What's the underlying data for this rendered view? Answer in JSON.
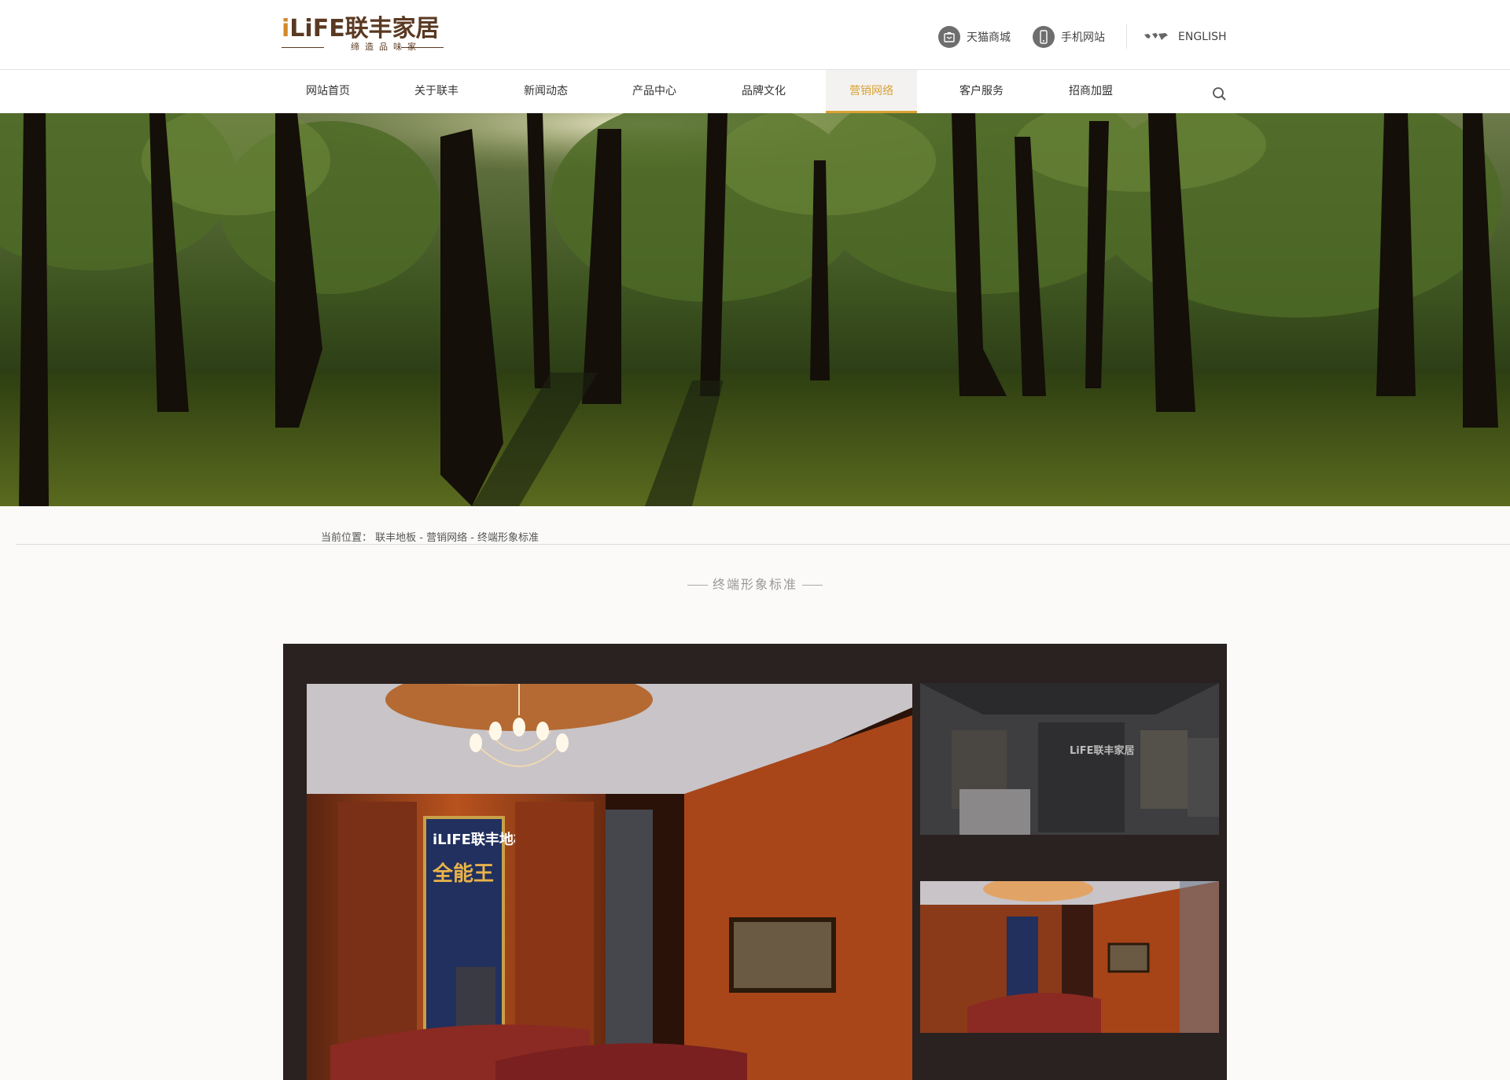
{
  "logo": {
    "brand": "LiFE联丰家居",
    "brand_i": "i",
    "tagline": "缔造品味家"
  },
  "toplinks": [
    {
      "label": "天猫商城",
      "icon": "tmall-bag-icon"
    },
    {
      "label": "手机网站",
      "icon": "mobile-phone-icon"
    },
    {
      "label": "ENGLISH",
      "icon": "world-map-icon"
    }
  ],
  "nav": {
    "items": [
      {
        "label": "网站首页"
      },
      {
        "label": "关于联丰"
      },
      {
        "label": "新闻动态"
      },
      {
        "label": "产品中心"
      },
      {
        "label": "品牌文化"
      },
      {
        "label": "营销网络",
        "active": true
      },
      {
        "label": "客户服务"
      },
      {
        "label": "招商加盟"
      }
    ],
    "active_color": "#d8a133"
  },
  "breadcrumb": {
    "text": "当前位置： 联丰地板 - 营销网络 - 终端形象标准"
  },
  "section": {
    "title": "终端形象标准"
  },
  "gallery": {
    "poster_brand": "iLIFE联丰地板",
    "poster_headline": "全能王",
    "store_sign": "LiFE联丰家居"
  }
}
